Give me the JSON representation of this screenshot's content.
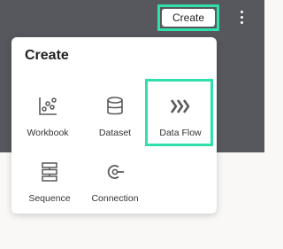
{
  "header": {
    "create_button_label": "Create",
    "more_menu_icon": "kebab-vertical-icon"
  },
  "create_menu": {
    "title": "Create",
    "items": [
      {
        "label": "Workbook",
        "icon": "workbook-chart-icon"
      },
      {
        "label": "Dataset",
        "icon": "database-icon"
      },
      {
        "label": "Data Flow",
        "icon": "data-flow-icon"
      },
      {
        "label": "Sequence",
        "icon": "sequence-icon"
      },
      {
        "label": "Connection",
        "icon": "connection-icon"
      }
    ]
  },
  "colors": {
    "highlight": "#2fdfac",
    "topbar": "#56585d",
    "icon": "#5a5a5a"
  }
}
